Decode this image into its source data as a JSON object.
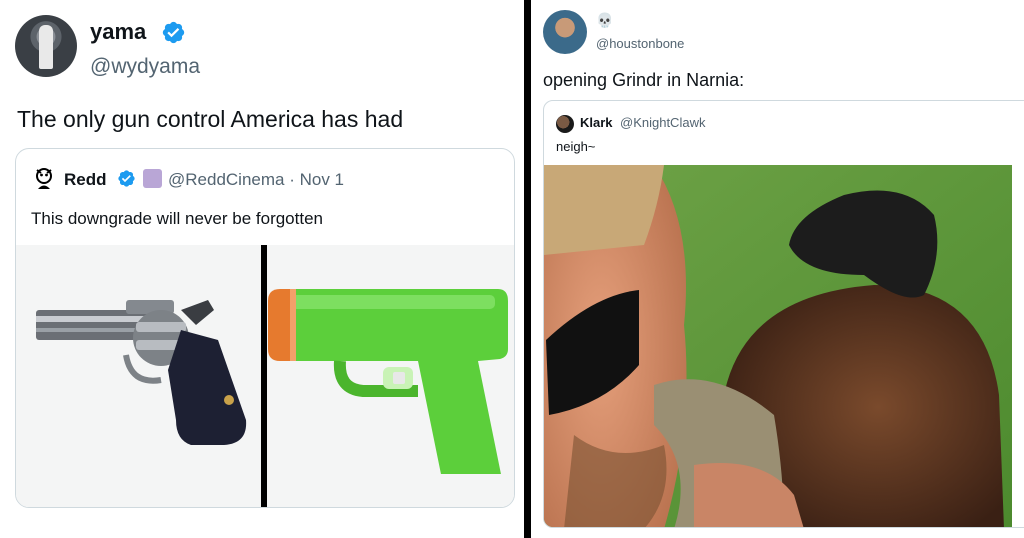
{
  "left_tweet": {
    "author": {
      "name": "yama",
      "handle": "@wydyama",
      "verified": true
    },
    "text": "The only gun control America has had",
    "quote": {
      "author": {
        "name": "Redd",
        "handle": "@ReddCinema",
        "verified": true
      },
      "meta": "@ReddCinema · Nov 1",
      "text": "This downgrade will never be forgotten",
      "media": {
        "left_icon": "revolver-emoji-icon",
        "right_icon": "water-pistol-emoji-icon"
      }
    }
  },
  "right_tweet": {
    "author": {
      "handle": "@houstonbone",
      "display_emoji": "💀"
    },
    "text": "opening Grindr in Narnia:",
    "quote": {
      "author": {
        "name": "Klark",
        "handle": "@KnightClawk"
      },
      "text": "neigh~",
      "media": {
        "icon": "selfie-with-horse-photo"
      }
    }
  },
  "colors": {
    "verified_blue": "#1d9bf0",
    "handle_gray": "#536471",
    "border": "#cfd9de",
    "water_gun_green": "#5ccf3b",
    "water_gun_orange": "#e67a2e"
  }
}
